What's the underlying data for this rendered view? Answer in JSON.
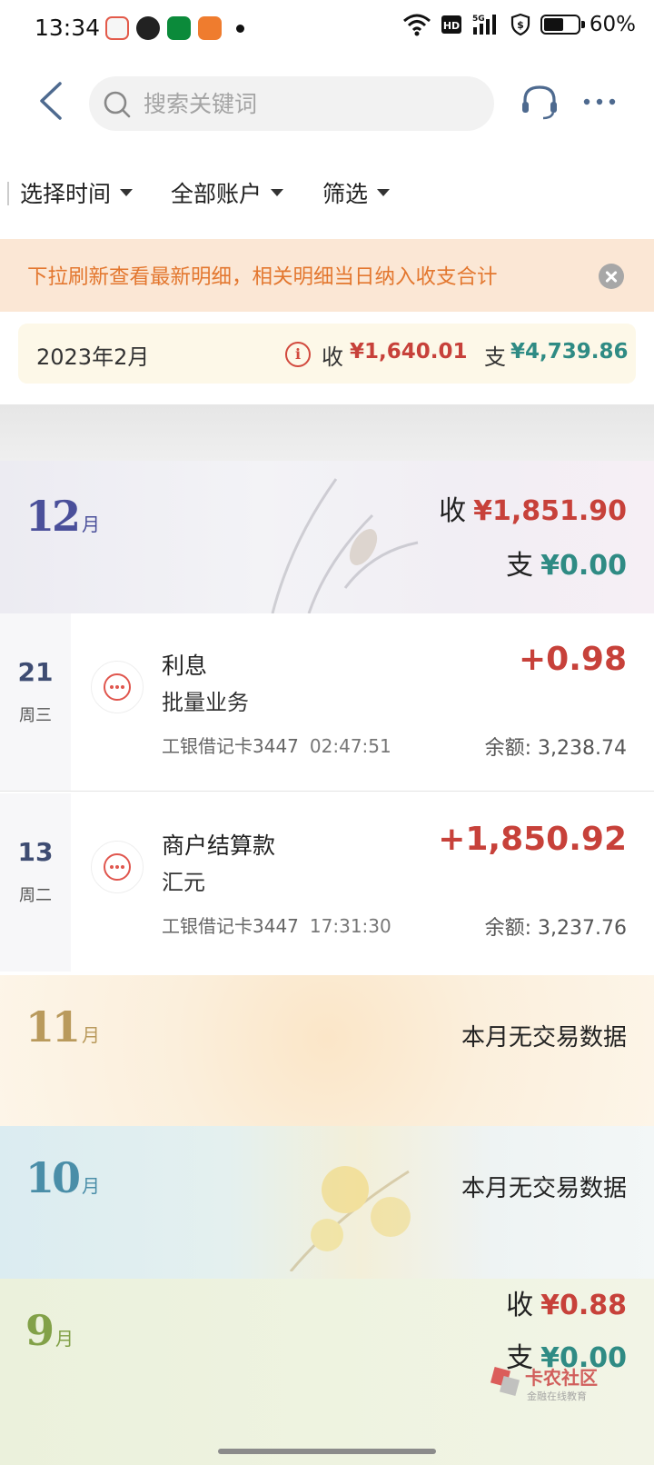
{
  "status_bar": {
    "time": "13:34",
    "battery_percent": "60%",
    "battery_level": 0.6,
    "icons": [
      "game-icon",
      "video-app-icon",
      "oppo-app-icon",
      "book-app-icon",
      "wifi-icon",
      "hd-icon",
      "signal-5g-icon",
      "shield-dollar-icon",
      "battery-icon"
    ]
  },
  "header": {
    "search_placeholder": "搜索关键词"
  },
  "filters": {
    "time": "选择时间",
    "account": "全部账户",
    "filter": "筛选"
  },
  "notice": {
    "text": "下拉刷新查看最新明细，相关明细当日纳入收支合计"
  },
  "summary": {
    "month": "2023年2月",
    "income_label": "收",
    "income": "¥1,640.01",
    "expense_label": "支",
    "expense": "¥4,739.86"
  },
  "months": {
    "dec": {
      "num": "12",
      "unit": "月",
      "income_label": "收",
      "income": "¥1,851.90",
      "expense_label": "支",
      "expense": "¥0.00"
    },
    "nov": {
      "num": "11",
      "unit": "月",
      "no_data": "本月无交易数据"
    },
    "oct": {
      "num": "10",
      "unit": "月",
      "no_data": "本月无交易数据"
    },
    "sep": {
      "num": "9",
      "unit": "月",
      "income_label": "收",
      "income": "¥0.88",
      "expense_label": "支",
      "expense": "¥0.00"
    }
  },
  "transactions": [
    {
      "day": "21",
      "weekday": "周三",
      "title": "利息",
      "subtitle": "批量业务",
      "account": "工银借记卡3447",
      "time": "02:47:51",
      "amount": "+0.98",
      "balance": "余额: 3,238.74"
    },
    {
      "day": "13",
      "weekday": "周二",
      "title": "商户结算款",
      "subtitle": "汇元",
      "account": "工银借记卡3447",
      "time": "17:31:30",
      "amount": "+1,850.92",
      "balance": "余额: 3,237.76"
    }
  ],
  "watermark": {
    "title": "卡农社区",
    "subtitle": "金融在线教育"
  },
  "colors": {
    "income": "#c7413a",
    "expense": "#2f8b84",
    "notice_bg": "#fbe7d5",
    "notice_text": "#e3772f"
  }
}
